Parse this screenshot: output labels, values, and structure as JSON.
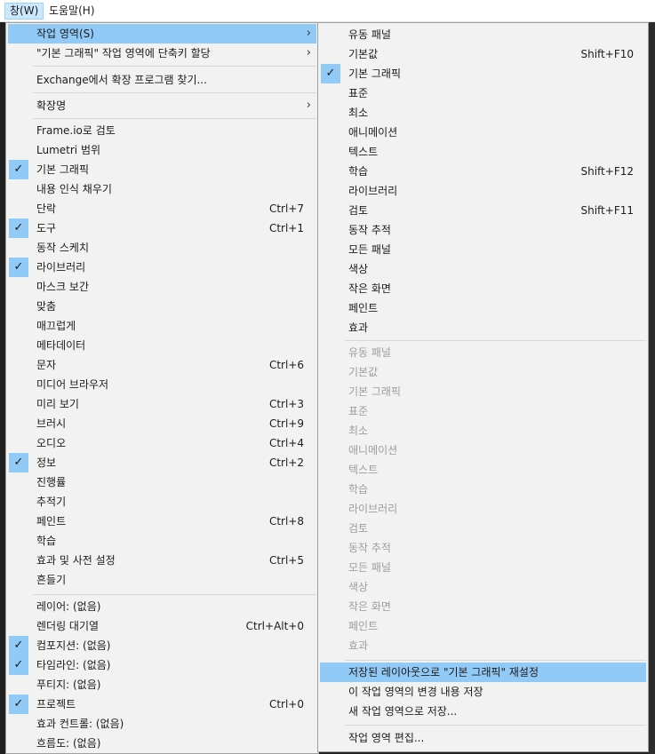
{
  "menubar": {
    "window_label": "창(W)",
    "help_label": "도움말(H)"
  },
  "main_menu": {
    "items": [
      {
        "label": "작업 영역(S)",
        "shortcut": "",
        "checked": false,
        "submenu": true,
        "highlighted": true
      },
      {
        "label": "\"기본 그래픽\" 작업 영역에 단축키 할당",
        "shortcut": "",
        "checked": false,
        "submenu": true
      },
      {
        "label": "Exchange에서 확장 프로그램 찾기...",
        "shortcut": "",
        "checked": false
      },
      {
        "label": "확장명",
        "shortcut": "",
        "checked": false,
        "submenu": true
      },
      {
        "label": "Frame.io로 검토",
        "shortcut": "",
        "checked": false
      },
      {
        "label": "Lumetri 범위",
        "shortcut": "",
        "checked": false
      },
      {
        "label": "기본 그래픽",
        "shortcut": "",
        "checked": true
      },
      {
        "label": "내용 인식 채우기",
        "shortcut": "",
        "checked": false
      },
      {
        "label": "단락",
        "shortcut": "Ctrl+7",
        "checked": false
      },
      {
        "label": "도구",
        "shortcut": "Ctrl+1",
        "checked": true
      },
      {
        "label": "동작 스케치",
        "shortcut": "",
        "checked": false
      },
      {
        "label": "라이브러리",
        "shortcut": "",
        "checked": true
      },
      {
        "label": "마스크 보간",
        "shortcut": "",
        "checked": false
      },
      {
        "label": "맞춤",
        "shortcut": "",
        "checked": false
      },
      {
        "label": "매끄럽게",
        "shortcut": "",
        "checked": false
      },
      {
        "label": "메타데이터",
        "shortcut": "",
        "checked": false
      },
      {
        "label": "문자",
        "shortcut": "Ctrl+6",
        "checked": false
      },
      {
        "label": "미디어 브라우저",
        "shortcut": "",
        "checked": false
      },
      {
        "label": "미리 보기",
        "shortcut": "Ctrl+3",
        "checked": false
      },
      {
        "label": "브러시",
        "shortcut": "Ctrl+9",
        "checked": false
      },
      {
        "label": "오디오",
        "shortcut": "Ctrl+4",
        "checked": false
      },
      {
        "label": "정보",
        "shortcut": "Ctrl+2",
        "checked": true
      },
      {
        "label": "진행률",
        "shortcut": "",
        "checked": false
      },
      {
        "label": "추적기",
        "shortcut": "",
        "checked": false
      },
      {
        "label": "페인트",
        "shortcut": "Ctrl+8",
        "checked": false
      },
      {
        "label": "학습",
        "shortcut": "",
        "checked": false
      },
      {
        "label": "효과 및 사전 설정",
        "shortcut": "Ctrl+5",
        "checked": false
      },
      {
        "label": "흔들기",
        "shortcut": "",
        "checked": false
      },
      {
        "label": "레이어: (없음)",
        "shortcut": "",
        "checked": false
      },
      {
        "label": "렌더링 대기열",
        "shortcut": "Ctrl+Alt+0",
        "checked": false
      },
      {
        "label": "컴포지션: (없음)",
        "shortcut": "",
        "checked": true
      },
      {
        "label": "타임라인: (없음)",
        "shortcut": "",
        "checked": true
      },
      {
        "label": "푸티지: (없음)",
        "shortcut": "",
        "checked": false
      },
      {
        "label": "프로젝트",
        "shortcut": "Ctrl+0",
        "checked": true
      },
      {
        "label": "효과 컨트롤: (없음)",
        "shortcut": "",
        "checked": false
      },
      {
        "label": "흐름도: (없음)",
        "shortcut": "",
        "checked": false
      }
    ]
  },
  "sub_menu": {
    "items": [
      {
        "label": "유동 패널",
        "shortcut": "",
        "checked": false
      },
      {
        "label": "기본값",
        "shortcut": "Shift+F10",
        "checked": false
      },
      {
        "label": "기본 그래픽",
        "shortcut": "",
        "checked": true
      },
      {
        "label": "표준",
        "shortcut": "",
        "checked": false
      },
      {
        "label": "최소",
        "shortcut": "",
        "checked": false
      },
      {
        "label": "애니메이션",
        "shortcut": "",
        "checked": false
      },
      {
        "label": "텍스트",
        "shortcut": "",
        "checked": false
      },
      {
        "label": "학습",
        "shortcut": "Shift+F12",
        "checked": false
      },
      {
        "label": "라이브러리",
        "shortcut": "",
        "checked": false
      },
      {
        "label": "검토",
        "shortcut": "Shift+F11",
        "checked": false
      },
      {
        "label": "동작 추적",
        "shortcut": "",
        "checked": false
      },
      {
        "label": "모든 패널",
        "shortcut": "",
        "checked": false
      },
      {
        "label": "색상",
        "shortcut": "",
        "checked": false
      },
      {
        "label": "작은 화면",
        "shortcut": "",
        "checked": false
      },
      {
        "label": "페인트",
        "shortcut": "",
        "checked": false
      },
      {
        "label": "효과",
        "shortcut": "",
        "checked": false
      },
      {
        "label": "유동 패널",
        "disabled": true
      },
      {
        "label": "기본값",
        "disabled": true
      },
      {
        "label": "기본 그래픽",
        "disabled": true
      },
      {
        "label": "표준",
        "disabled": true
      },
      {
        "label": "최소",
        "disabled": true
      },
      {
        "label": "애니메이션",
        "disabled": true
      },
      {
        "label": "텍스트",
        "disabled": true
      },
      {
        "label": "학습",
        "disabled": true
      },
      {
        "label": "라이브러리",
        "disabled": true
      },
      {
        "label": "검토",
        "disabled": true
      },
      {
        "label": "동작 추적",
        "disabled": true
      },
      {
        "label": "모든 패널",
        "disabled": true
      },
      {
        "label": "색상",
        "disabled": true
      },
      {
        "label": "작은 화면",
        "disabled": true
      },
      {
        "label": "페인트",
        "disabled": true
      },
      {
        "label": "효과",
        "disabled": true
      },
      {
        "label": "저장된 레이아웃으로 \"기본 그래픽\" 재설정",
        "highlighted": true
      },
      {
        "label": "이 작업 영역의 변경 내용 저장"
      },
      {
        "label": "새 작업 영역으로 저장..."
      },
      {
        "label": "작업 영역 편집..."
      }
    ]
  },
  "colors": {
    "highlight": "#91c9f7",
    "menu_bg": "#f2f2f2",
    "disabled_text": "#9d9d9d"
  }
}
